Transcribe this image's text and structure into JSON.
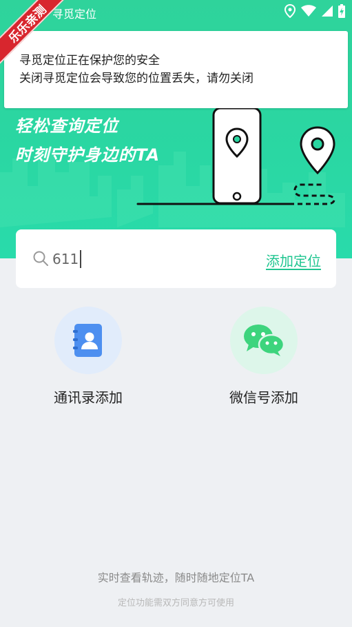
{
  "status_bar": {
    "title": "寻觅定位"
  },
  "watermark": {
    "text": "乐乐亲测"
  },
  "notice": {
    "line1": "寻觅定位正在保护您的安全",
    "line2": "关闭寻觅定位会导致您的位置丢失，请勿关闭"
  },
  "hero": {
    "slogan_line1": "轻松查询定位",
    "slogan_line2": "时刻守护身边的TA"
  },
  "search": {
    "value": "611",
    "add_label": "添加定位"
  },
  "options": [
    {
      "label": "通讯录添加",
      "icon": "contacts-book-icon"
    },
    {
      "label": "微信号添加",
      "icon": "wechat-icon"
    }
  ],
  "footer": {
    "tagline": "实时查看轨迹，随时随地定位TA",
    "note": "定位功能需双方同意方可使用"
  },
  "colors": {
    "primary": "#2ad7a3",
    "link": "#1fc590",
    "contacts_blue": "#4d8ff0",
    "wechat_green": "#3dd47d"
  }
}
